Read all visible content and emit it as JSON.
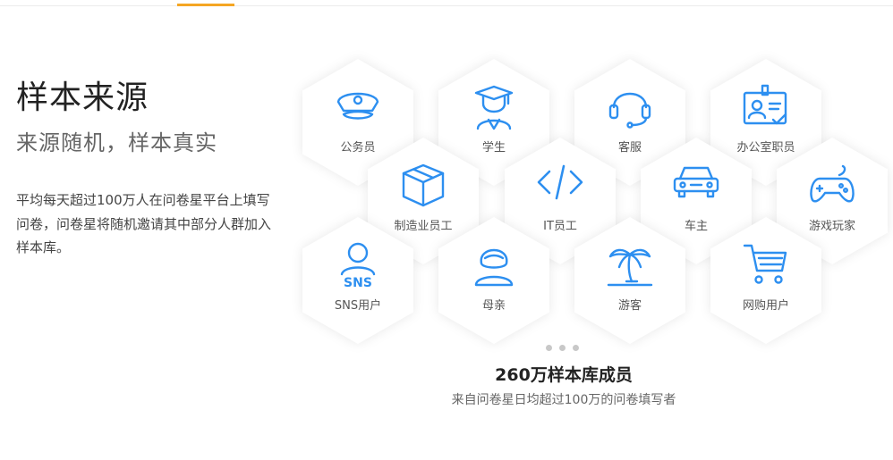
{
  "header": {
    "accent_color": "#f5a623"
  },
  "intro": {
    "title": "样本来源",
    "subtitle": "来源随机，样本真实",
    "description": "平均每天超过100万人在问卷星平台上填写问卷，问卷星将随机邀请其中部分人群加入样本库。"
  },
  "icon_color": "#2d8ff0",
  "hexagons": [
    {
      "label": "公务员",
      "icon": "police-cap-icon"
    },
    {
      "label": "学生",
      "icon": "graduate-icon"
    },
    {
      "label": "客服",
      "icon": "headset-icon"
    },
    {
      "label": "办公室职员",
      "icon": "id-badge-icon"
    },
    {
      "label": "制造业员工",
      "icon": "box-icon"
    },
    {
      "label": "IT员工",
      "icon": "code-icon"
    },
    {
      "label": "车主",
      "icon": "car-icon"
    },
    {
      "label": "游戏玩家",
      "icon": "gamepad-icon"
    },
    {
      "label": "SNS用户",
      "icon": "sns-user-icon",
      "icon_text": "SNS"
    },
    {
      "label": "母亲",
      "icon": "mother-icon"
    },
    {
      "label": "游客",
      "icon": "palm-tree-icon"
    },
    {
      "label": "网购用户",
      "icon": "shopping-cart-icon"
    }
  ],
  "carousel": {
    "dot_count": 3
  },
  "stats": {
    "title": "260万样本库成员",
    "subtitle": "来自问卷星日均超过100万的问卷填写者"
  }
}
